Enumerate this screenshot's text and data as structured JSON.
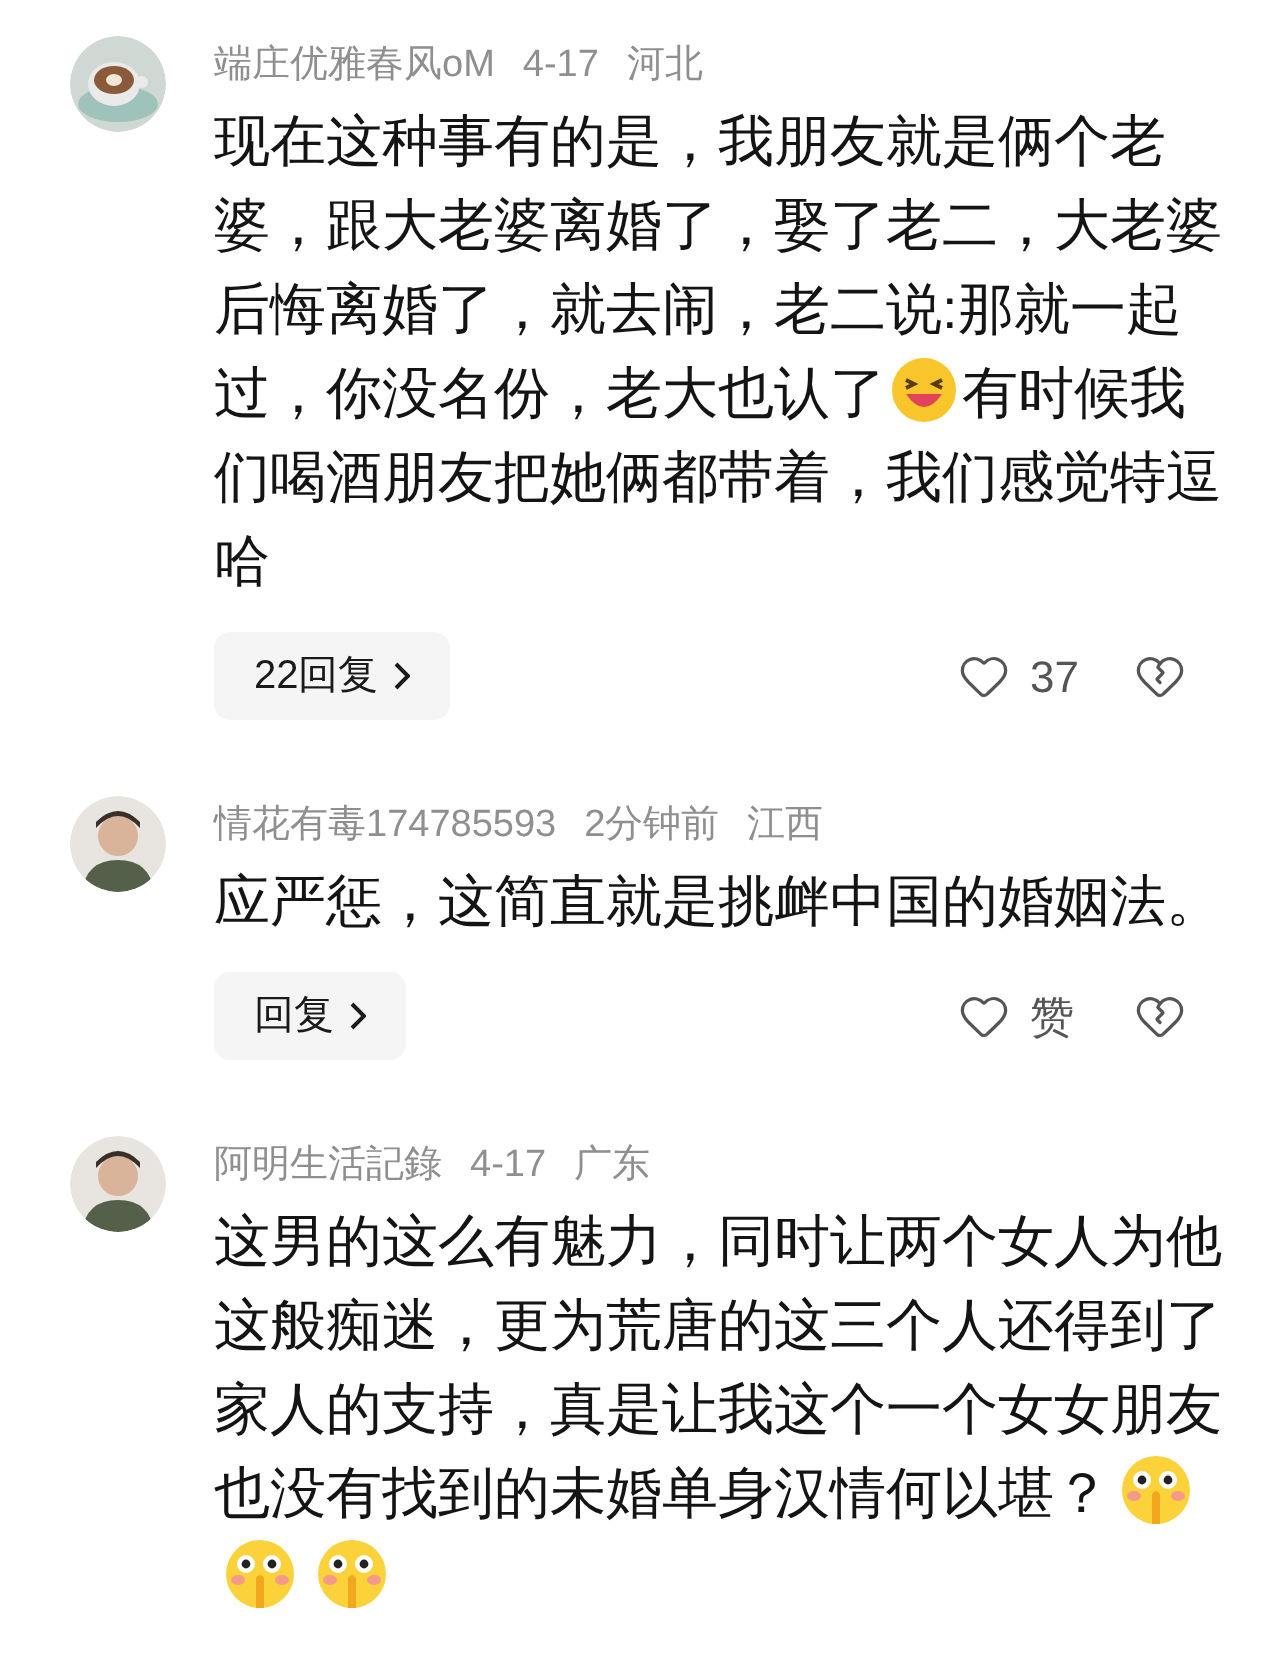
{
  "comments": [
    {
      "user": "端庄优雅春风oM",
      "time": "4-17",
      "location": "河北",
      "body": [
        {
          "kind": "text",
          "text": "现在这种事有的是，我朋友就是俩个老婆，跟大老婆离婚了，娶了老二，大老婆后悔离婚了，就去闹，老二说:那就一起过，你没名份，老大也认了"
        },
        {
          "kind": "laugh"
        },
        {
          "kind": "text",
          "text": "有时候我们喝酒朋友把她俩都带着，我们感觉特逗哈"
        }
      ],
      "reply_label": "22回复",
      "likes": "37"
    },
    {
      "user": "情花有毒174785593",
      "time": "2分钟前",
      "location": "江西",
      "body": [
        {
          "kind": "text",
          "text": "应严惩，这简直就是挑衅中国的婚姻法。"
        }
      ],
      "reply_label": "回复",
      "likes": "赞"
    },
    {
      "user": "阿明生活記錄",
      "time": "4-17",
      "location": "广东",
      "body": [
        {
          "kind": "text",
          "text": "这男的这么有魅力，同时让两个女人为他这般痴迷，更为荒唐的这三个人还得到了家人的支持，真是让我这个一个女女朋友也没有找到的未婚单身汉情何以堪？"
        },
        {
          "kind": "shush"
        },
        {
          "kind": "shush"
        },
        {
          "kind": "shush"
        }
      ]
    }
  ]
}
